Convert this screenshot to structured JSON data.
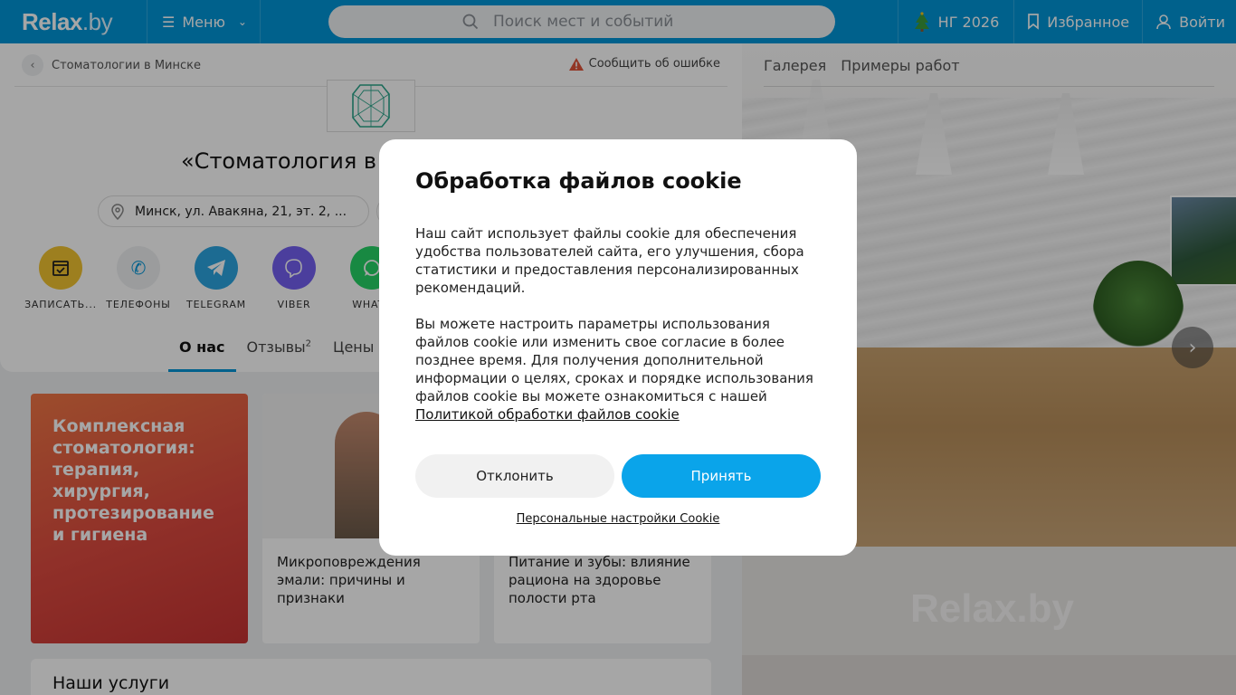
{
  "header": {
    "logo_main": "Relax",
    "logo_suffix": ".by",
    "menu_label": "Меню",
    "search_placeholder": "Поиск мест и событий",
    "ny_label": "НГ 2026",
    "favorites_label": "Избранное",
    "login_label": "Войти"
  },
  "page": {
    "breadcrumb": "Стоматологии в Минске",
    "report_error": "Сообщить об ошибке",
    "title": "«Стоматология в",
    "address": "Минск, ул. Авакяна, 21, эт. 2, ...",
    "actions": [
      {
        "label": "ЗАПИСАТЬ...",
        "color": "#f2c431"
      },
      {
        "label": "ТЕЛЕФОНЫ",
        "color": "#eef0f2"
      },
      {
        "label": "TELEGRAM",
        "color": "#2ca5e0"
      },
      {
        "label": "VIBER",
        "color": "#7360f2"
      },
      {
        "label": "WHATS",
        "color": "#25d366"
      }
    ],
    "tabs": [
      {
        "label": "О нас"
      },
      {
        "label": "Отзывы",
        "count": "2"
      },
      {
        "label": "Цены"
      }
    ],
    "promo_text": "Комплексная стоматология: терапия, хирургия, протезирование и гигиена",
    "articles": [
      {
        "title": "Микроповреждения эмали: причины и признаки"
      },
      {
        "title": "Питание и зубы: влияние рациона на здоровье полости рта"
      }
    ],
    "services_heading": "Наши услуги"
  },
  "gallery": {
    "tabs": [
      "Галерея",
      "Примеры работ"
    ],
    "watermark": "Relax.by"
  },
  "cookie": {
    "title": "Обработка файлов cookie",
    "paragraph1": "Наш сайт использует файлы cookie для обеспечения удобства пользователей сайта, его улучшения, сбора статистики и предоставления персонализированных рекомендаций.",
    "paragraph2": "Вы можете настроить параметры использования файлов cookie или изменить свое согласие в более позднее время. Для получения дополнительной информации о целях, сроках и порядке использования файлов cookie вы можете ознакомиться с нашей",
    "policy_link": "Политикой обработки файлов cookie",
    "decline_label": "Отклонить",
    "accept_label": "Принять",
    "personal_settings_label": "Персональные настройки Cookie"
  },
  "colors": {
    "brand": "#0096d8",
    "accept": "#0aa4ea"
  }
}
